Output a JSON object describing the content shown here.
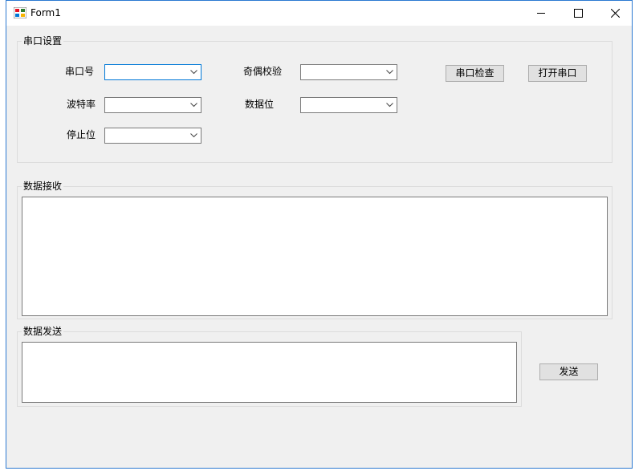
{
  "window": {
    "title": "Form1",
    "app_icon": "winforms-app-icon",
    "controls": {
      "minimize": "minimize-icon",
      "maximize": "maximize-icon",
      "close": "close-icon"
    }
  },
  "serial_settings": {
    "legend": "串口设置",
    "port_label": "串口号",
    "parity_label": "奇偶校验",
    "baud_label": "波特率",
    "databits_label": "数据位",
    "stopbits_label": "停止位",
    "port_value": "",
    "parity_value": "",
    "baud_value": "",
    "databits_value": "",
    "stopbits_value": "",
    "check_button": "串口检查",
    "open_button": "打开串口"
  },
  "receive": {
    "legend": "数据接收",
    "text": ""
  },
  "send": {
    "legend": "数据发送",
    "text": "",
    "button": "发送"
  },
  "colors": {
    "accent": "#0078d7",
    "window_border": "#2b79d1",
    "background": "#f0f0f0"
  }
}
